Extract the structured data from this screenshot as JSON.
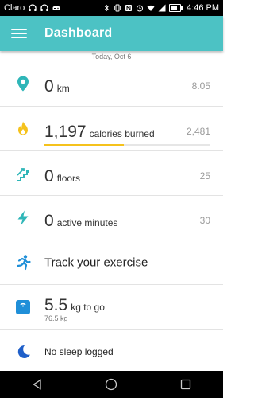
{
  "status_bar": {
    "carrier": "Claro",
    "time": "4:46 PM"
  },
  "app_bar": {
    "title": "Dashboard"
  },
  "date_label": "Today, Oct 6",
  "colors": {
    "accent": "#4cc2c4",
    "steps_icon": "#2fb6b8",
    "calories_icon": "#f5c21c",
    "exercise_icon": "#1f8fd8",
    "weight_icon": "#1f8fd8",
    "sleep_icon": "#1f5fc9"
  },
  "rows": {
    "distance": {
      "icon": "location-pin-icon",
      "value": "0",
      "unit": "km",
      "goal": "8.05"
    },
    "calories": {
      "icon": "flame-icon",
      "value": "1,197",
      "unit": "calories burned",
      "goal": "2,481",
      "progress": 0.48
    },
    "floors": {
      "icon": "stairs-icon",
      "value": "0",
      "unit": "floors",
      "goal": "25"
    },
    "active": {
      "icon": "lightning-bolt-icon",
      "value": "0",
      "unit": "active minutes",
      "goal": "30"
    },
    "exercise": {
      "icon": "running-person-icon",
      "label": "Track your exercise"
    },
    "weight": {
      "icon": "scale-icon",
      "value": "5.5",
      "unit": "kg to go",
      "current": "76.5 kg"
    },
    "sleep": {
      "icon": "moon-icon",
      "label": "No sleep logged"
    }
  }
}
